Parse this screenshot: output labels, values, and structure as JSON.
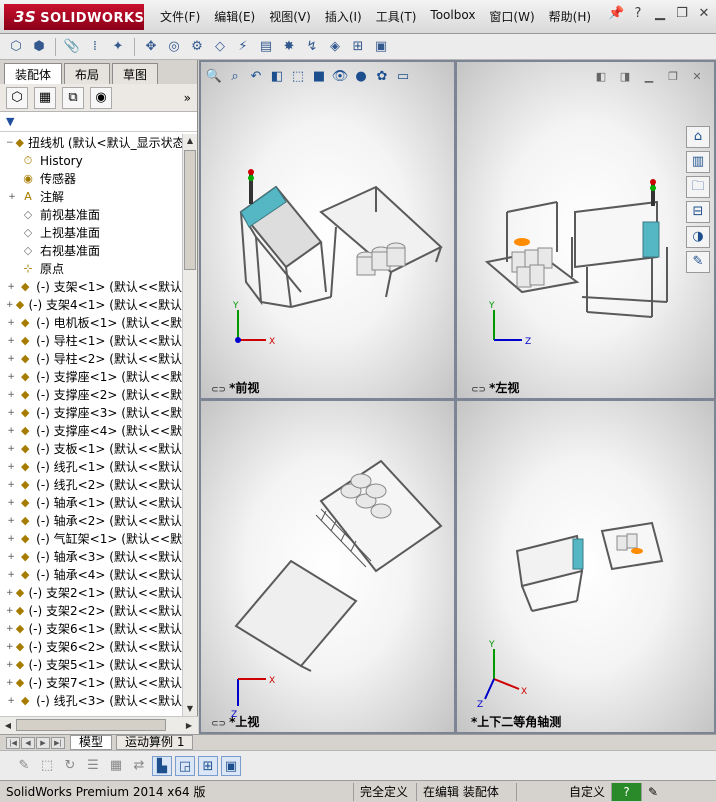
{
  "app": {
    "logo_text": "SOLIDWORKS",
    "logo_mark": "3S"
  },
  "menu": [
    "文件(F)",
    "编辑(E)",
    "视图(V)",
    "插入(I)",
    "工具(T)",
    "Toolbox",
    "窗口(W)",
    "帮助(H)"
  ],
  "feature_tabs": [
    "装配体",
    "布局",
    "草图"
  ],
  "tree": {
    "root": "扭线机  (默认<默认_显示状态",
    "items": [
      {
        "label": "History",
        "icon": "history-icon",
        "exp": ""
      },
      {
        "label": "传感器",
        "icon": "sensor-icon",
        "exp": ""
      },
      {
        "label": "注解",
        "icon": "annotation-icon",
        "exp": "+"
      },
      {
        "label": "前视基准面",
        "icon": "plane-icon",
        "exp": ""
      },
      {
        "label": "上视基准面",
        "icon": "plane-icon",
        "exp": ""
      },
      {
        "label": "右视基准面",
        "icon": "plane-icon",
        "exp": ""
      },
      {
        "label": "原点",
        "icon": "origin-icon",
        "exp": ""
      },
      {
        "label": "(-) 支架<1>  (默认<<默认",
        "icon": "part-icon",
        "exp": "+"
      },
      {
        "label": "(-) 支架4<1>  (默认<<默认",
        "icon": "part-icon",
        "exp": "+"
      },
      {
        "label": "(-) 电机板<1>  (默认<<默",
        "icon": "part-icon",
        "exp": "+"
      },
      {
        "label": "(-) 导柱<1>  (默认<<默认",
        "icon": "part-icon",
        "exp": "+"
      },
      {
        "label": "(-) 导柱<2>  (默认<<默认",
        "icon": "part-icon",
        "exp": "+"
      },
      {
        "label": "(-) 支撑座<1>  (默认<<默",
        "icon": "part-icon",
        "exp": "+"
      },
      {
        "label": "(-) 支撑座<2>  (默认<<默",
        "icon": "part-icon",
        "exp": "+"
      },
      {
        "label": "(-) 支撑座<3>  (默认<<默",
        "icon": "part-icon",
        "exp": "+"
      },
      {
        "label": "(-) 支撑座<4>  (默认<<默",
        "icon": "part-icon",
        "exp": "+"
      },
      {
        "label": "(-) 支板<1>  (默认<<默认",
        "icon": "part-icon",
        "exp": "+"
      },
      {
        "label": "(-) 线孔<1>  (默认<<默认",
        "icon": "part-icon",
        "exp": "+"
      },
      {
        "label": "(-) 线孔<2>  (默认<<默认",
        "icon": "part-icon",
        "exp": "+"
      },
      {
        "label": "(-) 轴承<1>  (默认<<默认",
        "icon": "part-icon",
        "exp": "+"
      },
      {
        "label": "(-) 轴承<2>  (默认<<默认",
        "icon": "part-icon",
        "exp": "+"
      },
      {
        "label": "(-) 气缸架<1>  (默认<<默",
        "icon": "part-icon",
        "exp": "+"
      },
      {
        "label": "(-) 轴承<3>  (默认<<默认",
        "icon": "part-icon",
        "exp": "+"
      },
      {
        "label": "(-) 轴承<4>  (默认<<默认",
        "icon": "part-icon",
        "exp": "+"
      },
      {
        "label": "(-) 支架2<1>  (默认<<默认",
        "icon": "part-icon",
        "exp": "+"
      },
      {
        "label": "(-) 支架2<2>  (默认<<默认",
        "icon": "part-icon",
        "exp": "+"
      },
      {
        "label": "(-) 支架6<1>  (默认<<默认",
        "icon": "part-icon",
        "exp": "+"
      },
      {
        "label": "(-) 支架6<2>  (默认<<默认",
        "icon": "part-icon",
        "exp": "+"
      },
      {
        "label": "(-) 支架5<1>  (默认<<默认",
        "icon": "part-icon",
        "exp": "+"
      },
      {
        "label": "(-) 支架7<1>  (默认<<默认",
        "icon": "part-icon",
        "exp": "+"
      },
      {
        "label": "(-) 线孔<3>  (默认<<默认",
        "icon": "part-icon",
        "exp": "+"
      }
    ]
  },
  "viewports": {
    "front": "*前视",
    "left": "*左视",
    "top": "*上视",
    "iso": "*上下二等角轴测"
  },
  "axis_letters": {
    "x": "X",
    "y": "Y",
    "z": "Z"
  },
  "bottom_tabs": [
    "模型",
    "运动算例 1"
  ],
  "status": {
    "app_version": "SolidWorks Premium 2014 x64 版",
    "definition": "完全定义",
    "editing": "在编辑 装配体",
    "custom": "自定义"
  },
  "colors": {
    "accent_blue": "#1d4f8f",
    "brand_red": "#c8102e",
    "teal_panel": "#56b7c4"
  }
}
